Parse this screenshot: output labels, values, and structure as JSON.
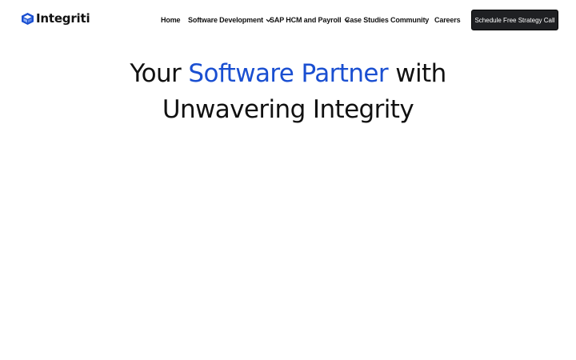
{
  "brand": {
    "name": "Integriti",
    "logo_icon": "cube-logo-icon",
    "accent_color": "#1a4fd1"
  },
  "nav": {
    "items": [
      {
        "label": "Home",
        "has_dropdown": false
      },
      {
        "label": "Software Development",
        "has_dropdown": true
      },
      {
        "label": "SAP HCM and Payroll",
        "has_dropdown": true
      },
      {
        "label": "Case Studies",
        "has_dropdown": false
      },
      {
        "label": "Community",
        "has_dropdown": false
      },
      {
        "label": "Careers",
        "has_dropdown": false
      }
    ],
    "cta_label": "Schedule Free Strategy Call"
  },
  "hero": {
    "line1_before": "Your ",
    "line1_accent": "Software Partner",
    "line1_after": " with",
    "line2": "Unwavering Integrity"
  }
}
